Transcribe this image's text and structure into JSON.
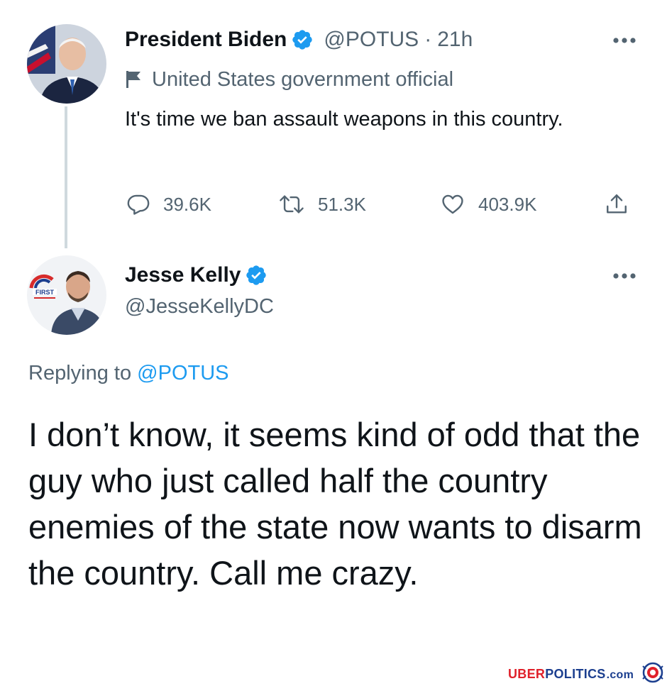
{
  "tweet1": {
    "display_name": "President Biden",
    "handle": "@POTUS",
    "separator": "·",
    "time": "21h",
    "label": "United States government official",
    "text": "It's time we ban assault weapons in this country.",
    "actions": {
      "replies": "39.6K",
      "retweets": "51.3K",
      "likes": "403.9K"
    }
  },
  "tweet2": {
    "display_name": "Jesse Kelly",
    "handle": "@JesseKellyDC",
    "replying_prefix": "Replying to ",
    "replying_to": "@POTUS",
    "text": "I don’t know, it seems kind of odd that the guy who just called half the country enemies of the state now wants to disarm the country. Call me crazy.",
    "avatar_badge": "FIRST"
  },
  "watermark": {
    "uber": "UBER",
    "politics": "POLITICS",
    "com": ".com"
  },
  "colors": {
    "text_primary": "#0f1419",
    "text_secondary": "#536471",
    "accent_blue": "#1d9bf0",
    "thread_line": "#cfd9de"
  },
  "icons": [
    "verified-badge-icon",
    "flag-icon",
    "more-icon",
    "reply-icon",
    "retweet-icon",
    "like-icon",
    "share-icon"
  ]
}
